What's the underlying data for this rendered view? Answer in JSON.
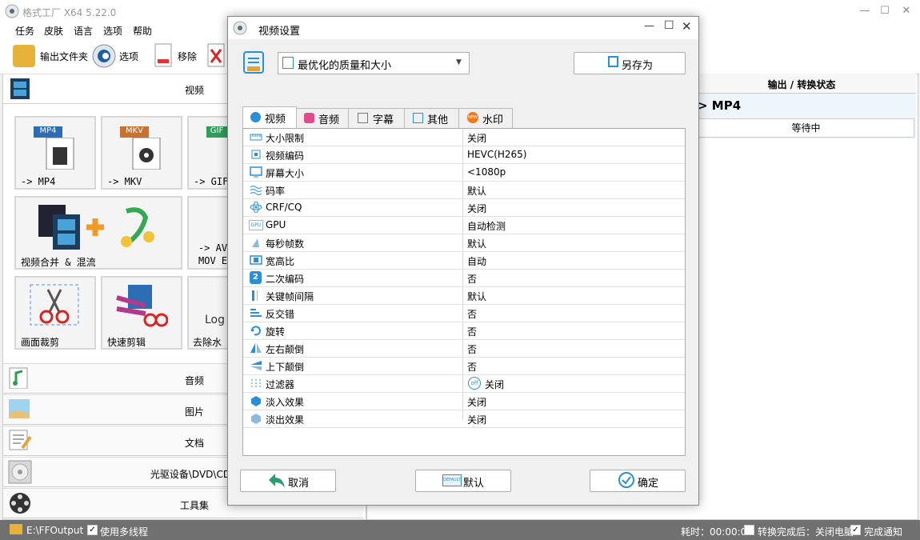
{
  "window": {
    "title": "格式工厂 X64 5.22.0"
  },
  "menu": [
    "任务",
    "皮肤",
    "语言",
    "选项",
    "帮助"
  ],
  "toolbar": {
    "output_folder": "输出文件夹",
    "options": "选项",
    "remove": "移除"
  },
  "left": {
    "video_category": "视频",
    "tiles": [
      {
        "label": "-> MP4",
        "badge": "MP4"
      },
      {
        "label": "-> MKV",
        "badge": "MKV"
      },
      {
        "label": "-> GIF",
        "badge": "GIF"
      },
      {
        "label": "视频合并 & 混流"
      },
      {
        "label": "-> AV",
        "label2": "MOV E"
      },
      {
        "label": "画面裁剪"
      },
      {
        "label": "快速剪辑"
      },
      {
        "label": "去除水"
      }
    ],
    "categories": [
      "音频",
      "图片",
      "文档",
      "光驱设备\\DVD\\CD\\",
      "工具集"
    ]
  },
  "right": {
    "header": "输出 / 转换状态",
    "task": "> MP4",
    "status": "等待中"
  },
  "statusbar": {
    "output_path": "E:\\FFOutput",
    "multithread": "使用多线程",
    "elapsed": "耗时：00:00:00",
    "after_convert": "转换完成后：关闭电脑",
    "notify": "完成通知"
  },
  "dialog": {
    "title": "视频设置",
    "preset": "最优化的质量和大小",
    "save_as": "另存为",
    "tabs": [
      "视频",
      "音频",
      "字幕",
      "其他",
      "水印"
    ],
    "watermark_badge": "NEW",
    "rows": [
      {
        "name": "大小限制",
        "value": "关闭"
      },
      {
        "name": "视频编码",
        "value": "HEVC(H265)"
      },
      {
        "name": "屏幕大小",
        "value": "<1080p"
      },
      {
        "name": "码率",
        "value": "默认"
      },
      {
        "name": "CRF/CQ",
        "value": "关闭"
      },
      {
        "name": "GPU",
        "value": "自动检测"
      },
      {
        "name": "每秒帧数",
        "value": "默认"
      },
      {
        "name": "宽高比",
        "value": "自动"
      },
      {
        "name": "二次编码",
        "value": "否"
      },
      {
        "name": "关键帧间隔",
        "value": "默认"
      },
      {
        "name": "反交错",
        "value": "否"
      },
      {
        "name": "旋转",
        "value": "否"
      },
      {
        "name": "左右颠倒",
        "value": "否"
      },
      {
        "name": "上下颠倒",
        "value": "否"
      },
      {
        "name": "过滤器",
        "value": "关闭",
        "badge": "off"
      },
      {
        "name": "淡入效果",
        "value": "关闭"
      },
      {
        "name": "淡出效果",
        "value": "关闭"
      }
    ],
    "gpu_icon_text": "GPU",
    "two_pass_icon_text": "2",
    "default_icon_text": "DEFAULT",
    "cancel": "取消",
    "default": "默认",
    "ok": "确定"
  },
  "colors": {
    "accent": "#2b8fd6",
    "statusbar": "#707070"
  }
}
